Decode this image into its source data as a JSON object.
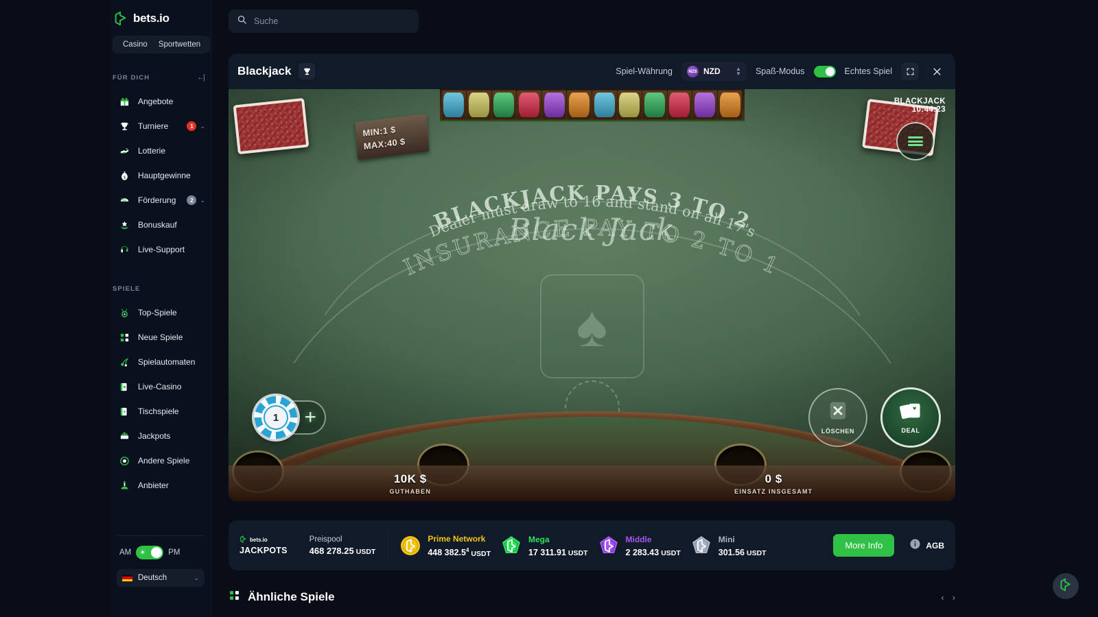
{
  "brand": {
    "name": "bets.io",
    "logo_icon": "bets-logo-icon"
  },
  "nav_tabs": [
    {
      "label": "Casino"
    },
    {
      "label": "Sportwetten"
    }
  ],
  "search": {
    "placeholder": "Suche",
    "value": "",
    "icon": "search-icon"
  },
  "sidebar": {
    "sections": [
      {
        "title": "FÜR DICH",
        "collapse_icon": "collapse-left-icon",
        "items": [
          {
            "label": "Angebote",
            "icon": "gift-icon"
          },
          {
            "label": "Turniere",
            "icon": "trophy-icon",
            "badge": "1",
            "badge_color": "red",
            "chevron": "⌄"
          },
          {
            "label": "Lotterie",
            "icon": "lottery-icon"
          },
          {
            "label": "Hauptgewinne",
            "icon": "moneybag-icon"
          },
          {
            "label": "Förderung",
            "icon": "promo-icon",
            "badge": "2",
            "badge_color": "grey",
            "chevron": "⌄"
          },
          {
            "label": "Bonuskauf",
            "icon": "bonus-buy-icon"
          },
          {
            "label": "Live-Support",
            "icon": "headset-icon"
          }
        ]
      },
      {
        "title": "SPIELE",
        "items": [
          {
            "label": "Top-Spiele",
            "icon": "medal-icon"
          },
          {
            "label": "Neue Spiele",
            "icon": "new-games-icon"
          },
          {
            "label": "Spielautomaten",
            "icon": "slots-icon"
          },
          {
            "label": "Live-Casino",
            "icon": "live-casino-icon"
          },
          {
            "label": "Tischspiele",
            "icon": "table-games-icon"
          },
          {
            "label": "Jackpots",
            "icon": "jackpot-icon"
          },
          {
            "label": "Andere Spiele",
            "icon": "other-games-icon"
          },
          {
            "label": "Anbieter",
            "icon": "providers-icon"
          }
        ]
      }
    ],
    "theme_toggle": {
      "left_label": "AM",
      "right_label": "PM",
      "state": "on"
    },
    "language": {
      "label": "Deutsch",
      "flag": "de-flag-icon",
      "chevron": "⌄"
    }
  },
  "game": {
    "title": "Blackjack",
    "tournament_icon": "trophy-icon",
    "currency_label": "Spiel-Währung",
    "currency": {
      "code": "NZD",
      "symbol": "NZ$"
    },
    "fun_mode_label": "Spaß-Modus",
    "real_play_label": "Echtes Spiel",
    "fullscreen_icon": "fullscreen-icon",
    "close_icon": "close-icon",
    "hud": {
      "name": "BLACKJACK",
      "time": "10:44:23",
      "menu_icon": "menu-icon"
    },
    "table": {
      "script_title": "Black Jack",
      "pays_line": "BLACKJACK PAYS  3 TO 2",
      "dealer_line": "Dealer must draw to 16 and stand on all 17's",
      "insurance_line": "INSURANCE PAY TO 2 TO 1",
      "min_label": "MIN:1 $",
      "max_label": "MAX:40 $",
      "spade_glyph": "♠"
    },
    "chip_value": "1",
    "chip_add_icon": "plus-icon",
    "actions": [
      {
        "label": "LÖSCHEN",
        "icon": "clear-x-icon",
        "name": "clear-button"
      },
      {
        "label": "DEAL",
        "icon": "cards-icon",
        "name": "deal-button"
      }
    ],
    "footer": [
      {
        "value": "10K $",
        "label": "GUTHABEN"
      },
      {
        "value": "0 $",
        "label": "EINSATZ INSGESAMT"
      }
    ]
  },
  "jackpots": {
    "brand_small": "bets.io",
    "brand_word": "JACKPOTS",
    "pool_label": "Preispool",
    "pool_value": "468 278.25",
    "pool_currency": "USDT",
    "items": [
      {
        "name": "Prime Network",
        "amount": "448 382.5",
        "amount_sup": "4",
        "currency": "USDT",
        "color": "#f2c418"
      },
      {
        "name": "Mega",
        "amount": "17 311.91",
        "currency": "USDT",
        "color": "#2ee05e"
      },
      {
        "name": "Middle",
        "amount": "2 283.43",
        "currency": "USDT",
        "color": "#a457f0"
      },
      {
        "name": "Mini",
        "amount": "301.56",
        "currency": "USDT",
        "color": "#aab4c4"
      }
    ],
    "more_info_label": "More Info",
    "agb_label": "AGB",
    "agb_icon": "info-icon"
  },
  "similar": {
    "title": "Ähnliche Spiele",
    "icon": "new-games-icon",
    "prev_icon": "chevron-left-icon",
    "next_icon": "chevron-right-icon"
  },
  "fab": {
    "icon": "bets-logo-icon"
  },
  "colors": {
    "accent_green": "#2ec146",
    "panel": "#111a28",
    "page_bg": "#080d17",
    "badge_red": "#e53122"
  }
}
